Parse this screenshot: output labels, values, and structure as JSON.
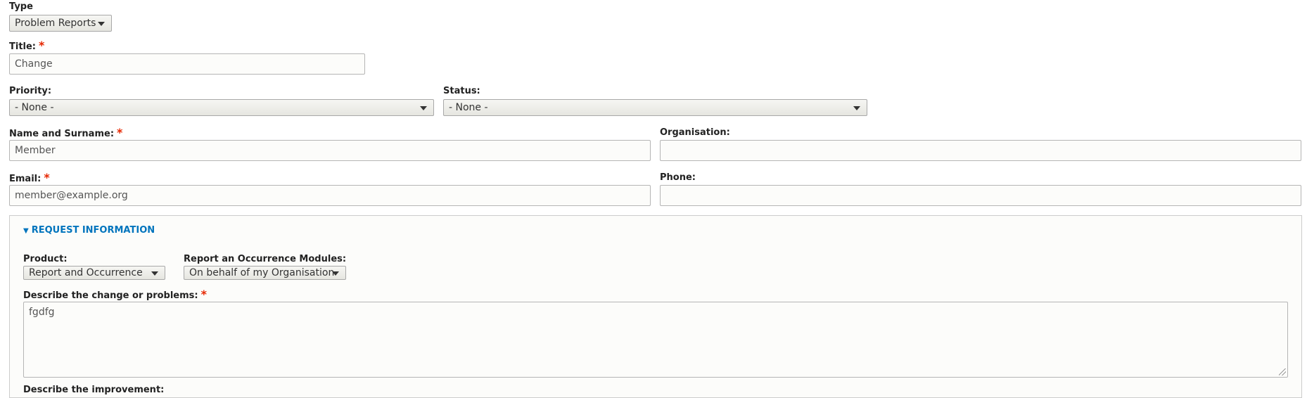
{
  "form": {
    "type": {
      "label": "Type",
      "value": "Problem Reports"
    },
    "title": {
      "label": "Title:",
      "required_mark": "*",
      "value": "Change"
    },
    "priority": {
      "label": "Priority:",
      "value": "- None -"
    },
    "status": {
      "label": "Status:",
      "value": "- None -"
    },
    "name": {
      "label": "Name and Surname:",
      "required_mark": "*",
      "value": "Member"
    },
    "organisation": {
      "label": "Organisation:",
      "value": ""
    },
    "email": {
      "label": "Email:",
      "required_mark": "*",
      "value": "member@example.org"
    },
    "phone": {
      "label": "Phone:",
      "value": ""
    }
  },
  "request_information": {
    "legend": "REQUEST INFORMATION",
    "legend_icon": "triangle-down-icon",
    "product": {
      "label": "Product:",
      "value": "Report and Occurrence"
    },
    "modules": {
      "label": "Report an Occurrence Modules:",
      "value": "On behalf of my Organisation"
    },
    "describe": {
      "label": "Describe the change or problems:",
      "required_mark": "*",
      "value": "fgdfg"
    },
    "improvement": {
      "label": "Describe the improvement:"
    }
  },
  "colors": {
    "required": "#e62600",
    "legend": "#0074bd",
    "field_border": "#b5b5b5",
    "fieldset_bg": "#fcfcfa"
  }
}
